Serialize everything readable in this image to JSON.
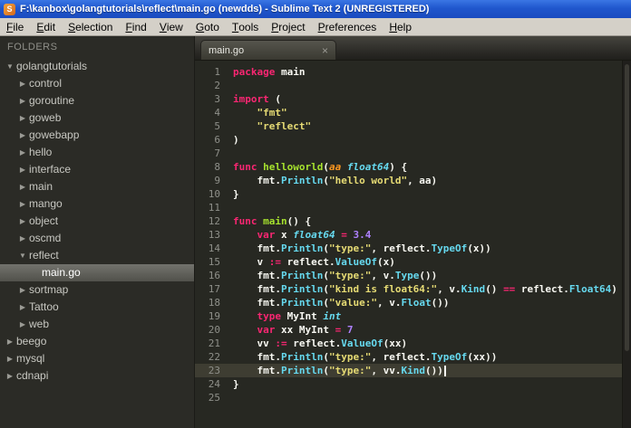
{
  "window": {
    "title": "F:\\kanbox\\golangtutorials\\reflect\\main.go (newdds) - Sublime Text 2 (UNREGISTERED)",
    "icon_letter": "S"
  },
  "menu": {
    "items": [
      "File",
      "Edit",
      "Selection",
      "Find",
      "View",
      "Goto",
      "Tools",
      "Project",
      "Preferences",
      "Help"
    ]
  },
  "sidebar": {
    "header": "FOLDERS",
    "items": [
      {
        "label": "golangtutorials",
        "level": 0,
        "type": "folder",
        "expanded": true,
        "selected": false
      },
      {
        "label": "control",
        "level": 1,
        "type": "folder",
        "expanded": false,
        "selected": false
      },
      {
        "label": "goroutine",
        "level": 1,
        "type": "folder",
        "expanded": false,
        "selected": false
      },
      {
        "label": "goweb",
        "level": 1,
        "type": "folder",
        "expanded": false,
        "selected": false
      },
      {
        "label": "gowebapp",
        "level": 1,
        "type": "folder",
        "expanded": false,
        "selected": false
      },
      {
        "label": "hello",
        "level": 1,
        "type": "folder",
        "expanded": false,
        "selected": false
      },
      {
        "label": "interface",
        "level": 1,
        "type": "folder",
        "expanded": false,
        "selected": false
      },
      {
        "label": "main",
        "level": 1,
        "type": "folder",
        "expanded": false,
        "selected": false
      },
      {
        "label": "mango",
        "level": 1,
        "type": "folder",
        "expanded": false,
        "selected": false
      },
      {
        "label": "object",
        "level": 1,
        "type": "folder",
        "expanded": false,
        "selected": false
      },
      {
        "label": "oscmd",
        "level": 1,
        "type": "folder",
        "expanded": false,
        "selected": false
      },
      {
        "label": "reflect",
        "level": 1,
        "type": "folder",
        "expanded": true,
        "selected": false
      },
      {
        "label": "main.go",
        "level": 2,
        "type": "file",
        "expanded": false,
        "selected": true
      },
      {
        "label": "sortmap",
        "level": 1,
        "type": "folder",
        "expanded": false,
        "selected": false
      },
      {
        "label": "Tattoo",
        "level": 1,
        "type": "folder",
        "expanded": false,
        "selected": false
      },
      {
        "label": "web",
        "level": 1,
        "type": "folder",
        "expanded": false,
        "selected": false
      },
      {
        "label": "beego",
        "level": 0,
        "type": "folder",
        "expanded": false,
        "selected": false
      },
      {
        "label": "mysql",
        "level": 0,
        "type": "folder",
        "expanded": false,
        "selected": false
      },
      {
        "label": "cdnapi",
        "level": 0,
        "type": "folder",
        "expanded": false,
        "selected": false
      }
    ]
  },
  "tabs": [
    {
      "label": "main.go",
      "active": true,
      "close_glyph": "×"
    }
  ],
  "editor": {
    "active_line": 23,
    "lines": [
      {
        "n": 1,
        "tokens": [
          [
            "kw",
            "package"
          ],
          [
            "p",
            " main"
          ]
        ]
      },
      {
        "n": 2,
        "tokens": []
      },
      {
        "n": 3,
        "tokens": [
          [
            "kw",
            "import"
          ],
          [
            "p",
            " ("
          ]
        ]
      },
      {
        "n": 4,
        "tokens": [
          [
            "p",
            "    "
          ],
          [
            "str",
            "\"fmt\""
          ]
        ]
      },
      {
        "n": 5,
        "tokens": [
          [
            "p",
            "    "
          ],
          [
            "str",
            "\"reflect\""
          ]
        ]
      },
      {
        "n": 6,
        "tokens": [
          [
            "p",
            ")"
          ]
        ]
      },
      {
        "n": 7,
        "tokens": []
      },
      {
        "n": 8,
        "tokens": [
          [
            "kw",
            "func"
          ],
          [
            "p",
            " "
          ],
          [
            "fn",
            "helloworld"
          ],
          [
            "p",
            "("
          ],
          [
            "pa",
            "aa"
          ],
          [
            "p",
            " "
          ],
          [
            "ty",
            "float64"
          ],
          [
            "p",
            ") {"
          ]
        ]
      },
      {
        "n": 9,
        "tokens": [
          [
            "p",
            "    fmt."
          ],
          [
            "fi",
            "Println"
          ],
          [
            "p",
            "("
          ],
          [
            "str",
            "\"hello world\""
          ],
          [
            "p",
            ", aa)"
          ]
        ]
      },
      {
        "n": 10,
        "tokens": [
          [
            "p",
            "}"
          ]
        ]
      },
      {
        "n": 11,
        "tokens": []
      },
      {
        "n": 12,
        "tokens": [
          [
            "kw",
            "func"
          ],
          [
            "p",
            " "
          ],
          [
            "fn",
            "main"
          ],
          [
            "p",
            "() {"
          ]
        ]
      },
      {
        "n": 13,
        "tokens": [
          [
            "p",
            "    "
          ],
          [
            "kw",
            "var"
          ],
          [
            "p",
            " x "
          ],
          [
            "ty",
            "float64"
          ],
          [
            "p",
            " "
          ],
          [
            "op",
            "="
          ],
          [
            "p",
            " "
          ],
          [
            "num",
            "3.4"
          ]
        ]
      },
      {
        "n": 14,
        "tokens": [
          [
            "p",
            "    fmt."
          ],
          [
            "fi",
            "Println"
          ],
          [
            "p",
            "("
          ],
          [
            "str",
            "\"type:\""
          ],
          [
            "p",
            ", reflect."
          ],
          [
            "fi",
            "TypeOf"
          ],
          [
            "p",
            "(x))"
          ]
        ]
      },
      {
        "n": 15,
        "tokens": [
          [
            "p",
            "    v "
          ],
          [
            "op",
            ":="
          ],
          [
            "p",
            " reflect."
          ],
          [
            "fi",
            "ValueOf"
          ],
          [
            "p",
            "(x)"
          ]
        ]
      },
      {
        "n": 16,
        "tokens": [
          [
            "p",
            "    fmt."
          ],
          [
            "fi",
            "Println"
          ],
          [
            "p",
            "("
          ],
          [
            "str",
            "\"type:\""
          ],
          [
            "p",
            ", v."
          ],
          [
            "fi",
            "Type"
          ],
          [
            "p",
            "())"
          ]
        ]
      },
      {
        "n": 17,
        "tokens": [
          [
            "p",
            "    fmt."
          ],
          [
            "fi",
            "Println"
          ],
          [
            "p",
            "("
          ],
          [
            "str",
            "\"kind is float64:\""
          ],
          [
            "p",
            ", v."
          ],
          [
            "fi",
            "Kind"
          ],
          [
            "p",
            "() "
          ],
          [
            "op",
            "=="
          ],
          [
            "p",
            " reflect."
          ],
          [
            "fi",
            "Float64"
          ],
          [
            "p",
            ")"
          ]
        ]
      },
      {
        "n": 18,
        "tokens": [
          [
            "p",
            "    fmt."
          ],
          [
            "fi",
            "Println"
          ],
          [
            "p",
            "("
          ],
          [
            "str",
            "\"value:\""
          ],
          [
            "p",
            ", v."
          ],
          [
            "fi",
            "Float"
          ],
          [
            "p",
            "())"
          ]
        ]
      },
      {
        "n": 19,
        "tokens": [
          [
            "p",
            "    "
          ],
          [
            "kw",
            "type"
          ],
          [
            "p",
            " MyInt "
          ],
          [
            "ty",
            "int"
          ]
        ]
      },
      {
        "n": 20,
        "tokens": [
          [
            "p",
            "    "
          ],
          [
            "kw",
            "var"
          ],
          [
            "p",
            " xx MyInt "
          ],
          [
            "op",
            "="
          ],
          [
            "p",
            " "
          ],
          [
            "num",
            "7"
          ]
        ]
      },
      {
        "n": 21,
        "tokens": [
          [
            "p",
            "    vv "
          ],
          [
            "op",
            ":="
          ],
          [
            "p",
            " reflect."
          ],
          [
            "fi",
            "ValueOf"
          ],
          [
            "p",
            "(xx)"
          ]
        ]
      },
      {
        "n": 22,
        "tokens": [
          [
            "p",
            "    fmt."
          ],
          [
            "fi",
            "Println"
          ],
          [
            "p",
            "("
          ],
          [
            "str",
            "\"type:\""
          ],
          [
            "p",
            ", reflect."
          ],
          [
            "fi",
            "TypeOf"
          ],
          [
            "p",
            "(xx))"
          ]
        ]
      },
      {
        "n": 23,
        "tokens": [
          [
            "p",
            "    fmt."
          ],
          [
            "fi",
            "Println"
          ],
          [
            "p",
            "("
          ],
          [
            "str",
            "\"type:\""
          ],
          [
            "p",
            ", vv."
          ],
          [
            "fi",
            "Kind"
          ],
          [
            "p",
            "())"
          ]
        ]
      },
      {
        "n": 24,
        "tokens": [
          [
            "p",
            "}"
          ]
        ]
      },
      {
        "n": 25,
        "tokens": []
      }
    ]
  },
  "colors": {
    "editor_bg": "#272822",
    "active_line_bg": "#3e3d32",
    "keyword": "#f92672",
    "function_name": "#a6e22e",
    "type_italic": "#66d9ef",
    "function_call": "#66d9ef",
    "string": "#e6db74",
    "number": "#ae81ff",
    "plain": "#f8f8f2",
    "line_number": "#8f908a",
    "titlebar_blue": "#2057cd"
  }
}
